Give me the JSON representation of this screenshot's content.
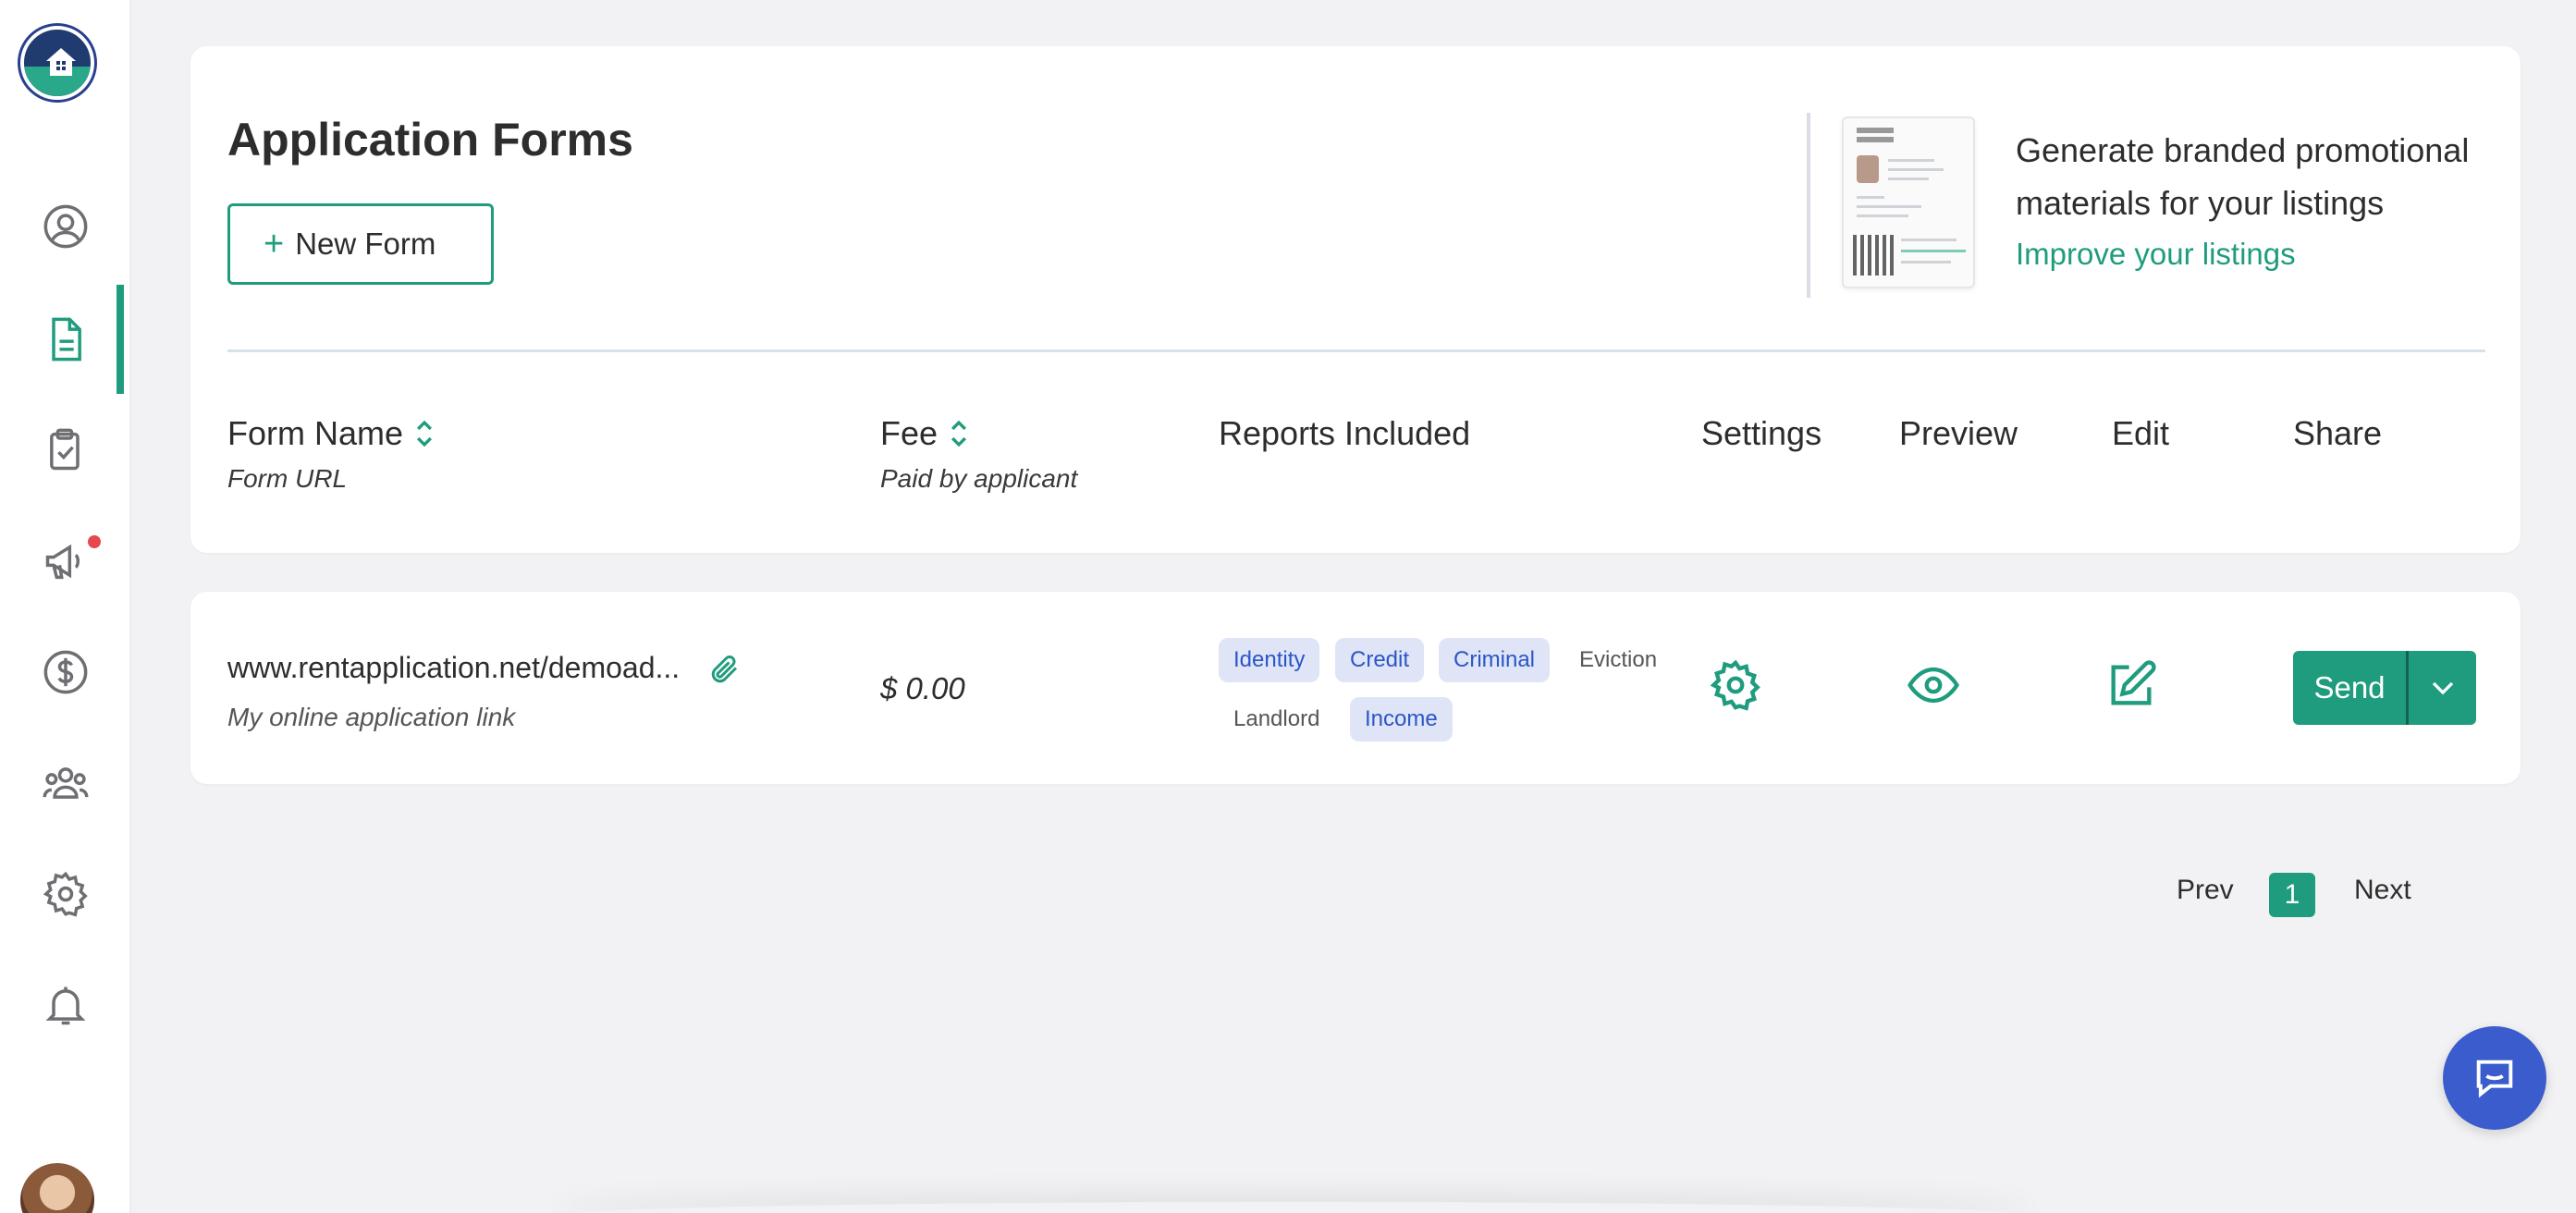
{
  "sidebar": {
    "items": [
      {
        "name": "profile",
        "icon": "user-circle-icon"
      },
      {
        "name": "forms",
        "icon": "document-icon",
        "active": true
      },
      {
        "name": "applications",
        "icon": "clipboard-check-icon"
      },
      {
        "name": "marketing",
        "icon": "megaphone-icon",
        "notification": true
      },
      {
        "name": "payments",
        "icon": "dollar-circle-icon"
      },
      {
        "name": "team",
        "icon": "users-icon"
      },
      {
        "name": "settings",
        "icon": "gear-icon"
      },
      {
        "name": "notifications",
        "icon": "bell-icon"
      }
    ]
  },
  "header": {
    "title": "Application Forms",
    "new_form_label": "New Form"
  },
  "promo": {
    "text": "Generate branded promotional materials for your listings",
    "link": "Improve your listings"
  },
  "columns": {
    "form_name": "Form Name",
    "form_url": "Form URL",
    "fee": "Fee",
    "fee_sub": "Paid by applicant",
    "reports": "Reports Included",
    "settings": "Settings",
    "preview": "Preview",
    "edit": "Edit",
    "share": "Share"
  },
  "rows": [
    {
      "url": "www.rentapplication.net/demoad...",
      "url_label": "My online application link",
      "fee": "$ 0.00",
      "tags": [
        {
          "label": "Identity",
          "included": true
        },
        {
          "label": "Credit",
          "included": true
        },
        {
          "label": "Criminal",
          "included": true
        },
        {
          "label": "Eviction",
          "included": false
        },
        {
          "label": "Landlord",
          "included": false
        },
        {
          "label": "Income",
          "included": true
        }
      ],
      "send_label": "Send"
    }
  ],
  "pagination": {
    "prev": "Prev",
    "current": "1",
    "next": "Next"
  },
  "colors": {
    "accent": "#1f9c7d",
    "tag_bg": "#dfe4f7",
    "tag_text": "#2a56c6",
    "chat": "#3a5ccc",
    "notification": "#e5484d"
  }
}
